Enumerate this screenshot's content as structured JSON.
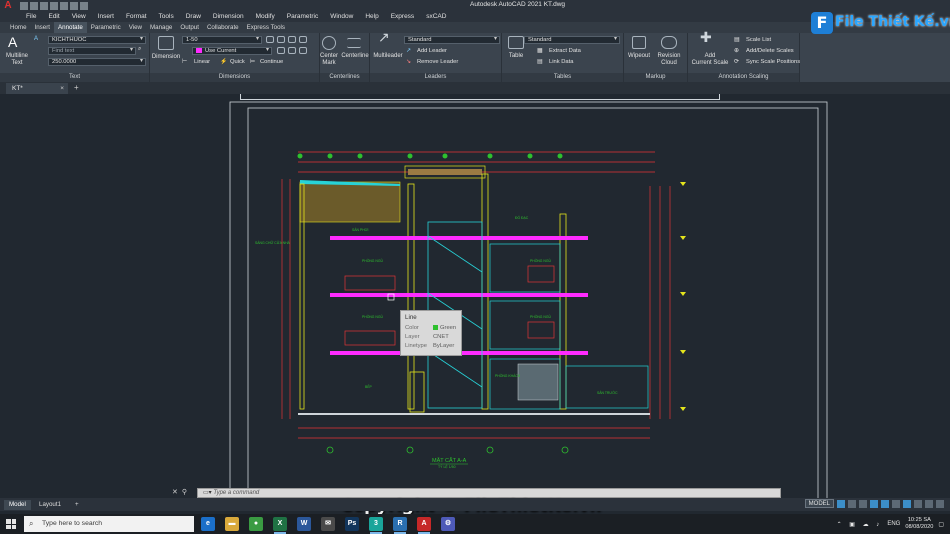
{
  "window": {
    "title": "Autodesk AutoCAD 2021    KT.dwg"
  },
  "menus": [
    "File",
    "Edit",
    "View",
    "Insert",
    "Format",
    "Tools",
    "Draw",
    "Dimension",
    "Modify",
    "Parametric",
    "Window",
    "Help",
    "Express",
    "sxCAD"
  ],
  "ribbon_tabs": [
    "Home",
    "Insert",
    "Annotate",
    "Parametric",
    "View",
    "Manage",
    "Output",
    "Collaborate",
    "Express Tools"
  ],
  "active_ribbon_tab": "Annotate",
  "ribbon": {
    "text_panel": {
      "title": "Text",
      "multiline_text": "Multiline\nText",
      "text_style": "KICHTHUOC",
      "find_text_placeholder": "Find text",
      "text_height": "250.0000"
    },
    "dimensions_panel": {
      "title": "Dimensions",
      "dimension": "Dimension",
      "dim_style": "1-50",
      "layer": "Use Current",
      "linear": "Linear",
      "quick": "Quick",
      "continue": "Continue"
    },
    "centerlines_panel": {
      "title": "Centerlines",
      "center_mark": "Center\nMark",
      "centerline": "Centerline"
    },
    "leaders_panel": {
      "title": "Leaders",
      "multileader": "Multileader",
      "style": "Standard",
      "add_leader": "Add Leader",
      "remove_leader": "Remove Leader"
    },
    "tables_panel": {
      "title": "Tables",
      "table": "Table",
      "style": "Standard",
      "extract_data": "Extract Data",
      "link_data": "Link Data"
    },
    "markup_panel": {
      "title": "Markup",
      "wipeout": "Wipeout",
      "revision_cloud": "Revision\nCloud"
    },
    "annotation_scaling_panel": {
      "title": "Annotation Scaling",
      "add_current_scale": "Add\nCurrent Scale",
      "scale_list": "Scale List",
      "add_delete_scales": "Add/Delete Scales",
      "sync_scale_positions": "Sync Scale Positions"
    }
  },
  "file_tab": {
    "name": "KT*"
  },
  "drawing": {
    "section_title": "MẶT CẮT A-A",
    "section_scale": "TỶ LỆ 1/50",
    "rooms": [
      "SÂN PHƠI",
      "PHÒNG NGỦ",
      "PHÒNG NGỦ",
      "PHÒNG NGỦ",
      "PHÒNG NGỦ",
      "BẾP",
      "PHÒNG KHÁCH",
      "SÂN TRƯỚC",
      "ĐÓ ĐẠC"
    ],
    "left_label": "SÀNG CHỮ CỬA NHÀ"
  },
  "tooltip": {
    "title": "Line",
    "rows": [
      {
        "key": "Color",
        "value": "Green",
        "swatch": "#2ec02e"
      },
      {
        "key": "Layer",
        "value": "CNET"
      },
      {
        "key": "Linetype",
        "value": "ByLayer"
      }
    ]
  },
  "command_line": {
    "placeholder": "Type a command"
  },
  "layout_tabs": [
    "Model",
    "Layout1"
  ],
  "active_layout": "Model",
  "status": {
    "model": "MODEL"
  },
  "taskbar": {
    "search_placeholder": "Type here to search",
    "apps": [
      {
        "name": "edge",
        "label": "e",
        "color": "#1b6fc9"
      },
      {
        "name": "explorer",
        "label": "▬",
        "color": "#d9a93b"
      },
      {
        "name": "chrome",
        "label": "●",
        "color": "#3a9b42"
      },
      {
        "name": "excel",
        "label": "X",
        "color": "#1f7244"
      },
      {
        "name": "word",
        "label": "W",
        "color": "#2b579a"
      },
      {
        "name": "mail",
        "label": "✉",
        "color": "#4a4a4a"
      },
      {
        "name": "photoshop",
        "label": "Ps",
        "color": "#12355b"
      },
      {
        "name": "3dsmax",
        "label": "3",
        "color": "#1aa59a"
      },
      {
        "name": "revit",
        "label": "R",
        "color": "#2a6fb0"
      },
      {
        "name": "autocad",
        "label": "A",
        "color": "#c62828"
      },
      {
        "name": "sketchup",
        "label": "⚙",
        "color": "#4e5ab8"
      }
    ],
    "language": "ENG",
    "time": "10:25 SA",
    "date": "08/08/2020"
  },
  "watermark": {
    "brand": "File Thiết Kế.vn",
    "copyright": "Copyright © FileThietKe.vn"
  },
  "colors": {
    "canvas": "#212830",
    "ribbon": "#3b444e",
    "magenta": "#ff2bff",
    "green": "#2ec02e",
    "cyan": "#27d3d8",
    "yellow": "#e5e51c",
    "red": "#e33535"
  }
}
